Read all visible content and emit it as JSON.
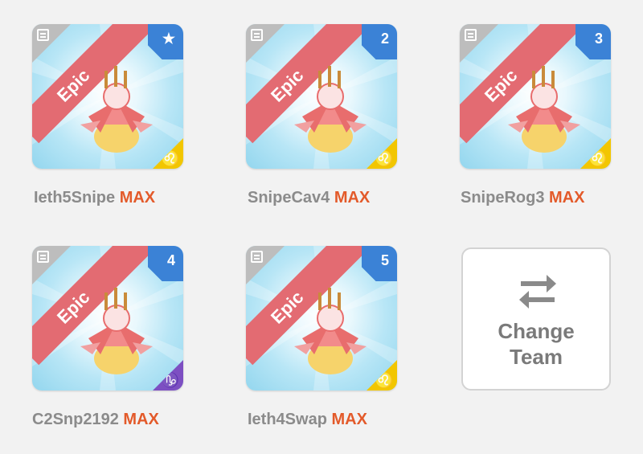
{
  "cards": [
    {
      "name": "Ieth5Snipe",
      "level": "MAX",
      "rarity": "Epic",
      "slot_badge": "★",
      "element": "♌",
      "element_color": "#f2c600"
    },
    {
      "name": "SnipeCav4",
      "level": "MAX",
      "rarity": "Epic",
      "slot_badge": "2",
      "element": "♌",
      "element_color": "#f2c600"
    },
    {
      "name": "SnipeRog3",
      "level": "MAX",
      "rarity": "Epic",
      "slot_badge": "3",
      "element": "♌",
      "element_color": "#f2c600"
    },
    {
      "name": "C2Snp2192",
      "level": "MAX",
      "rarity": "Epic",
      "slot_badge": "4",
      "element": "♑",
      "element_color": "#7d4fc2"
    },
    {
      "name": "Ieth4Swap",
      "level": "MAX",
      "rarity": "Epic",
      "slot_badge": "5",
      "element": "♌",
      "element_color": "#f2c600"
    }
  ],
  "change_team": {
    "label": "Change\nTeam",
    "icon": "swap-arrows-icon"
  },
  "colors": {
    "rarity_ribbon": "#e36b72",
    "slot_badge": "#3b82d6",
    "max_text": "#e35a2a",
    "name_text": "#8b8b8b"
  }
}
